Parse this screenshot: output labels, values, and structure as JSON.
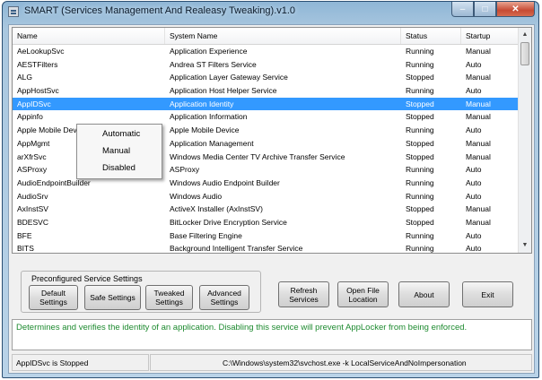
{
  "window": {
    "title": "SMART (Services Management And Realeasy Tweaking).v1.0"
  },
  "columns": [
    "Name",
    "System Name",
    "Status",
    "Startup"
  ],
  "rows": [
    [
      "AeLookupSvc",
      "Application Experience",
      "Running",
      "Manual"
    ],
    [
      "AESTFilters",
      "Andrea ST Filters Service",
      "Running",
      "Auto"
    ],
    [
      "ALG",
      "Application Layer Gateway Service",
      "Stopped",
      "Manual"
    ],
    [
      "AppHostSvc",
      "Application Host Helper Service",
      "Running",
      "Auto"
    ],
    [
      "AppIDSvc",
      "Application Identity",
      "Stopped",
      "Manual"
    ],
    [
      "Appinfo",
      "Application Information",
      "Stopped",
      "Manual"
    ],
    [
      "Apple Mobile Device",
      "Apple Mobile Device",
      "Running",
      "Auto"
    ],
    [
      "AppMgmt",
      "Application Management",
      "Stopped",
      "Manual"
    ],
    [
      "arXfrSvc",
      "Windows Media Center TV Archive Transfer Service",
      "Stopped",
      "Manual"
    ],
    [
      "ASProxy",
      "ASProxy",
      "Running",
      "Auto"
    ],
    [
      "AudioEndpointBuilder",
      "Windows Audio Endpoint Builder",
      "Running",
      "Auto"
    ],
    [
      "AudioSrv",
      "Windows Audio",
      "Running",
      "Auto"
    ],
    [
      "AxInstSV",
      "ActiveX Installer (AxInstSV)",
      "Stopped",
      "Manual"
    ],
    [
      "BDESVC",
      "BitLocker Drive Encryption Service",
      "Stopped",
      "Manual"
    ],
    [
      "BFE",
      "Base Filtering Engine",
      "Running",
      "Auto"
    ],
    [
      "BITS",
      "Background Intelligent Transfer Service",
      "Running",
      "Auto"
    ]
  ],
  "selected_row": 4,
  "context_menu": [
    "Automatic",
    "Manual",
    "Disabled"
  ],
  "preconfigured": {
    "label": "Preconfigured Service Settings",
    "default": "Default\nSettings",
    "safe": "Safe Settings",
    "tweaked": "Tweaked\nSettings",
    "advanced": "Advanced\nSettings"
  },
  "buttons": {
    "refresh": "Refresh\nServices",
    "open_file": "Open File\nLocation",
    "about": "About",
    "exit": "Exit"
  },
  "description": "Determines and verifies the identity of an application. Disabling this service will prevent AppLocker from being enforced.",
  "status_bar": {
    "left": "AppIDSvc is Stopped",
    "right": "C:\\Windows\\system32\\svchost.exe -k LocalServiceAndNoImpersonation"
  }
}
